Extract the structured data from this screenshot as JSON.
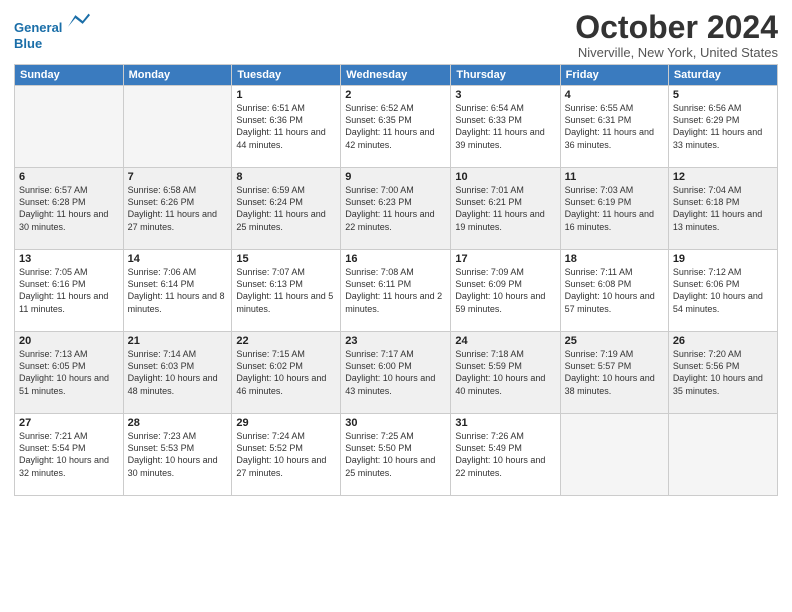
{
  "header": {
    "logo_line1": "General",
    "logo_line2": "Blue",
    "month": "October 2024",
    "location": "Niverville, New York, United States"
  },
  "weekdays": [
    "Sunday",
    "Monday",
    "Tuesday",
    "Wednesday",
    "Thursday",
    "Friday",
    "Saturday"
  ],
  "weeks": [
    [
      {
        "num": "",
        "info": ""
      },
      {
        "num": "",
        "info": ""
      },
      {
        "num": "1",
        "info": "Sunrise: 6:51 AM\nSunset: 6:36 PM\nDaylight: 11 hours and 44 minutes."
      },
      {
        "num": "2",
        "info": "Sunrise: 6:52 AM\nSunset: 6:35 PM\nDaylight: 11 hours and 42 minutes."
      },
      {
        "num": "3",
        "info": "Sunrise: 6:54 AM\nSunset: 6:33 PM\nDaylight: 11 hours and 39 minutes."
      },
      {
        "num": "4",
        "info": "Sunrise: 6:55 AM\nSunset: 6:31 PM\nDaylight: 11 hours and 36 minutes."
      },
      {
        "num": "5",
        "info": "Sunrise: 6:56 AM\nSunset: 6:29 PM\nDaylight: 11 hours and 33 minutes."
      }
    ],
    [
      {
        "num": "6",
        "info": "Sunrise: 6:57 AM\nSunset: 6:28 PM\nDaylight: 11 hours and 30 minutes."
      },
      {
        "num": "7",
        "info": "Sunrise: 6:58 AM\nSunset: 6:26 PM\nDaylight: 11 hours and 27 minutes."
      },
      {
        "num": "8",
        "info": "Sunrise: 6:59 AM\nSunset: 6:24 PM\nDaylight: 11 hours and 25 minutes."
      },
      {
        "num": "9",
        "info": "Sunrise: 7:00 AM\nSunset: 6:23 PM\nDaylight: 11 hours and 22 minutes."
      },
      {
        "num": "10",
        "info": "Sunrise: 7:01 AM\nSunset: 6:21 PM\nDaylight: 11 hours and 19 minutes."
      },
      {
        "num": "11",
        "info": "Sunrise: 7:03 AM\nSunset: 6:19 PM\nDaylight: 11 hours and 16 minutes."
      },
      {
        "num": "12",
        "info": "Sunrise: 7:04 AM\nSunset: 6:18 PM\nDaylight: 11 hours and 13 minutes."
      }
    ],
    [
      {
        "num": "13",
        "info": "Sunrise: 7:05 AM\nSunset: 6:16 PM\nDaylight: 11 hours and 11 minutes."
      },
      {
        "num": "14",
        "info": "Sunrise: 7:06 AM\nSunset: 6:14 PM\nDaylight: 11 hours and 8 minutes."
      },
      {
        "num": "15",
        "info": "Sunrise: 7:07 AM\nSunset: 6:13 PM\nDaylight: 11 hours and 5 minutes."
      },
      {
        "num": "16",
        "info": "Sunrise: 7:08 AM\nSunset: 6:11 PM\nDaylight: 11 hours and 2 minutes."
      },
      {
        "num": "17",
        "info": "Sunrise: 7:09 AM\nSunset: 6:09 PM\nDaylight: 10 hours and 59 minutes."
      },
      {
        "num": "18",
        "info": "Sunrise: 7:11 AM\nSunset: 6:08 PM\nDaylight: 10 hours and 57 minutes."
      },
      {
        "num": "19",
        "info": "Sunrise: 7:12 AM\nSunset: 6:06 PM\nDaylight: 10 hours and 54 minutes."
      }
    ],
    [
      {
        "num": "20",
        "info": "Sunrise: 7:13 AM\nSunset: 6:05 PM\nDaylight: 10 hours and 51 minutes."
      },
      {
        "num": "21",
        "info": "Sunrise: 7:14 AM\nSunset: 6:03 PM\nDaylight: 10 hours and 48 minutes."
      },
      {
        "num": "22",
        "info": "Sunrise: 7:15 AM\nSunset: 6:02 PM\nDaylight: 10 hours and 46 minutes."
      },
      {
        "num": "23",
        "info": "Sunrise: 7:17 AM\nSunset: 6:00 PM\nDaylight: 10 hours and 43 minutes."
      },
      {
        "num": "24",
        "info": "Sunrise: 7:18 AM\nSunset: 5:59 PM\nDaylight: 10 hours and 40 minutes."
      },
      {
        "num": "25",
        "info": "Sunrise: 7:19 AM\nSunset: 5:57 PM\nDaylight: 10 hours and 38 minutes."
      },
      {
        "num": "26",
        "info": "Sunrise: 7:20 AM\nSunset: 5:56 PM\nDaylight: 10 hours and 35 minutes."
      }
    ],
    [
      {
        "num": "27",
        "info": "Sunrise: 7:21 AM\nSunset: 5:54 PM\nDaylight: 10 hours and 32 minutes."
      },
      {
        "num": "28",
        "info": "Sunrise: 7:23 AM\nSunset: 5:53 PM\nDaylight: 10 hours and 30 minutes."
      },
      {
        "num": "29",
        "info": "Sunrise: 7:24 AM\nSunset: 5:52 PM\nDaylight: 10 hours and 27 minutes."
      },
      {
        "num": "30",
        "info": "Sunrise: 7:25 AM\nSunset: 5:50 PM\nDaylight: 10 hours and 25 minutes."
      },
      {
        "num": "31",
        "info": "Sunrise: 7:26 AM\nSunset: 5:49 PM\nDaylight: 10 hours and 22 minutes."
      },
      {
        "num": "",
        "info": ""
      },
      {
        "num": "",
        "info": ""
      }
    ]
  ]
}
